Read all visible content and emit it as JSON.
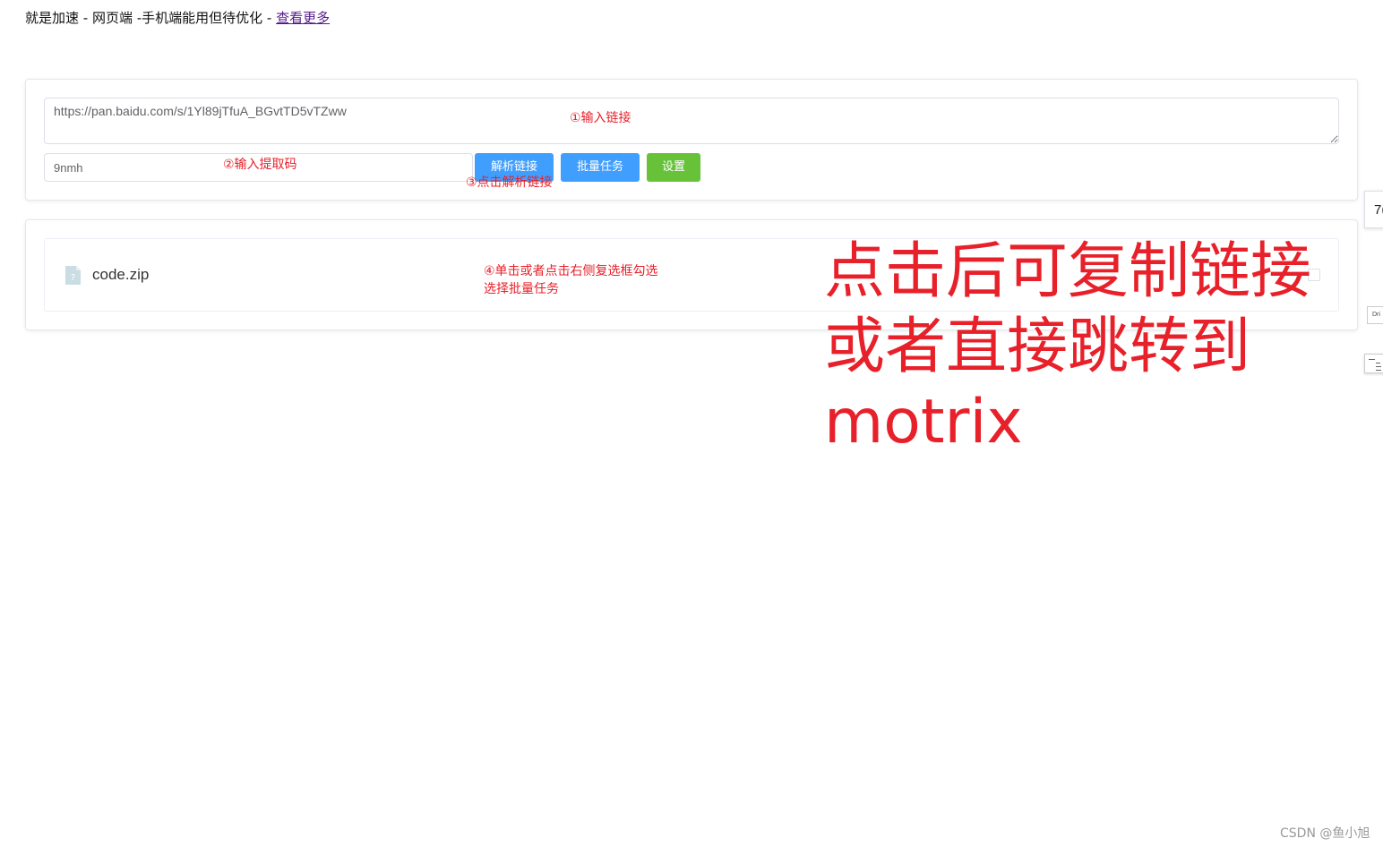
{
  "header": {
    "text": "就是加速 - 网页端 -手机端能用但待优化 - ",
    "link_text": "查看更多"
  },
  "form": {
    "link_value": "https://pan.baidu.com/s/1Yl89jTfuA_BGvtTD5vTZww",
    "code_value": "9nmh",
    "buttons": {
      "parse": "解析链接",
      "batch": "批量任务",
      "settings": "设置"
    }
  },
  "files": [
    {
      "name": "code.zip",
      "checked": false
    }
  ],
  "annotations": {
    "step1": "①输入链接",
    "step2": "②输入提取码",
    "step3": "③点击解析链接",
    "step4_line1": "④单击或者点击右侧复选框勾选",
    "step4_line2": "选择批量任务",
    "big_line1": "点击后可复制链接",
    "big_line2": "或者直接跳转到",
    "big_line3": "motrix",
    "color": "#e8202a"
  },
  "edge_widget": {
    "tab_text": "7(",
    "mini_text": "Dri"
  },
  "watermark": "CSDN @鱼小旭",
  "colors": {
    "primary": "#409eff",
    "success": "#67c23a",
    "border": "#dcdfe6"
  },
  "icons": {
    "file": "unknown-file-icon"
  }
}
